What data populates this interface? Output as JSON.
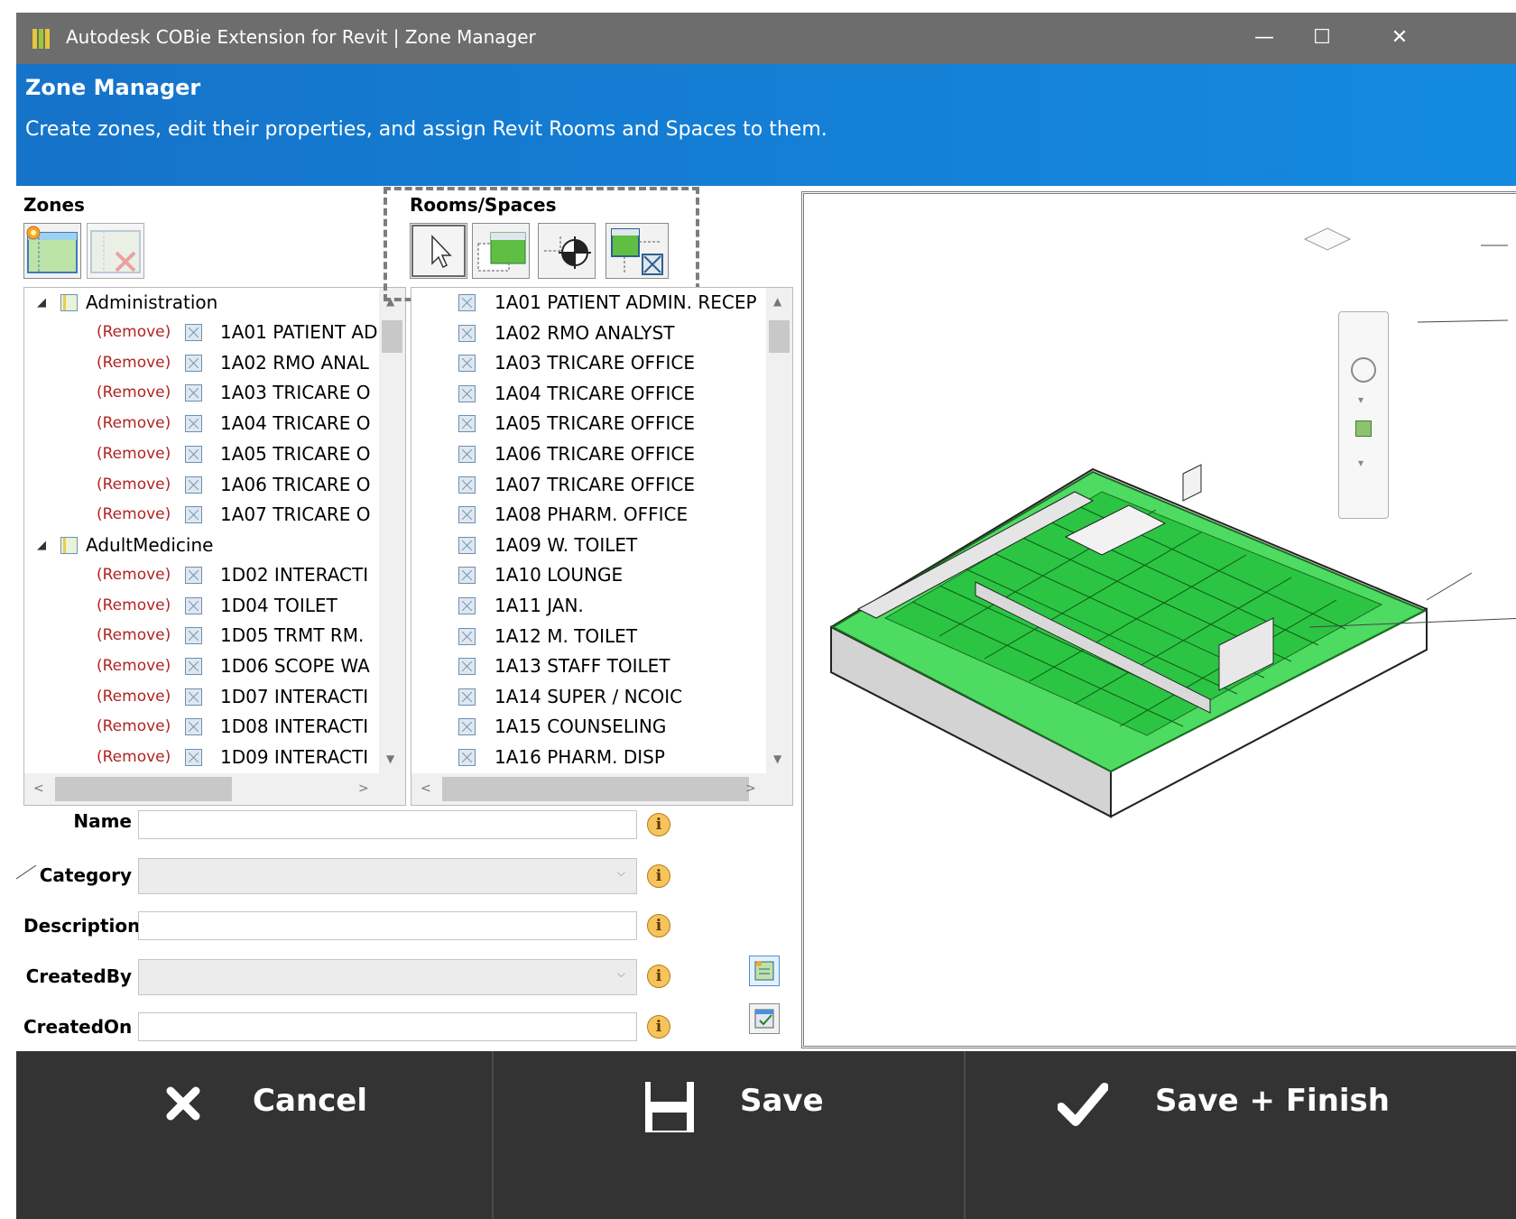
{
  "window": {
    "title": "Autodesk COBie Extension for Revit | Zone Manager",
    "controls": {
      "minimize": "—",
      "maximize": "☐",
      "close": "✕"
    }
  },
  "banner": {
    "title": "Zone Manager",
    "subtitle": "Create zones, edit their properties, and assign Revit Rooms and Spaces to them."
  },
  "zones": {
    "label": "Zones",
    "toolbar": [
      "add-zone-icon",
      "delete-zone-icon"
    ],
    "remove_label": "(Remove)",
    "groups": [
      {
        "name": "Administration",
        "items": [
          "1A01  PATIENT AD",
          "1A02  RMO ANAL",
          "1A03  TRICARE O",
          "1A04  TRICARE O",
          "1A05  TRICARE O",
          "1A06  TRICARE O",
          "1A07  TRICARE O"
        ]
      },
      {
        "name": "AdultMedicine",
        "items": [
          "1D02  INTERACTI",
          "1D04  TOILET",
          "1D05  TRMT RM.",
          "1D06  SCOPE WA",
          "1D07  INTERACTI",
          "1D08  INTERACTI",
          "1D09  INTERACTI"
        ]
      }
    ]
  },
  "rooms": {
    "label": "Rooms/Spaces",
    "toolbar": [
      "select-arrow-icon",
      "select-room-icon",
      "locate-icon",
      "filter-rooms-icon"
    ],
    "items": [
      "1A01  PATIENT ADMIN. RECEP",
      "1A02  RMO ANALYST",
      "1A03  TRICARE OFFICE",
      "1A04  TRICARE OFFICE",
      "1A05  TRICARE OFFICE",
      "1A06  TRICARE OFFICE",
      "1A07  TRICARE OFFICE",
      "1A08  PHARM. OFFICE",
      "1A09  W. TOILET",
      "1A10  LOUNGE",
      "1A11  JAN.",
      "1A12  M. TOILET",
      "1A13  STAFF TOILET",
      "1A14  SUPER / NCOIC",
      "1A15  COUNSELING",
      "1A16  PHARM. DISP"
    ]
  },
  "form": {
    "name_label": "Name",
    "category_label": "Category",
    "description_label": "Description",
    "createdby_label": "CreatedBy",
    "createdon_label": "CreatedOn",
    "name_value": "",
    "category_value": "",
    "description_value": "",
    "createdby_value": "",
    "createdon_value": "",
    "info_glyph": "i"
  },
  "footer": {
    "cancel": "Cancel",
    "save": "Save",
    "save_finish": "Save + Finish"
  },
  "colors": {
    "titlebar": "#6d6d6d",
    "banner": "#138ae0",
    "footer": "#333333",
    "remove_link": "#b22222",
    "model_green": "#32d84a"
  }
}
